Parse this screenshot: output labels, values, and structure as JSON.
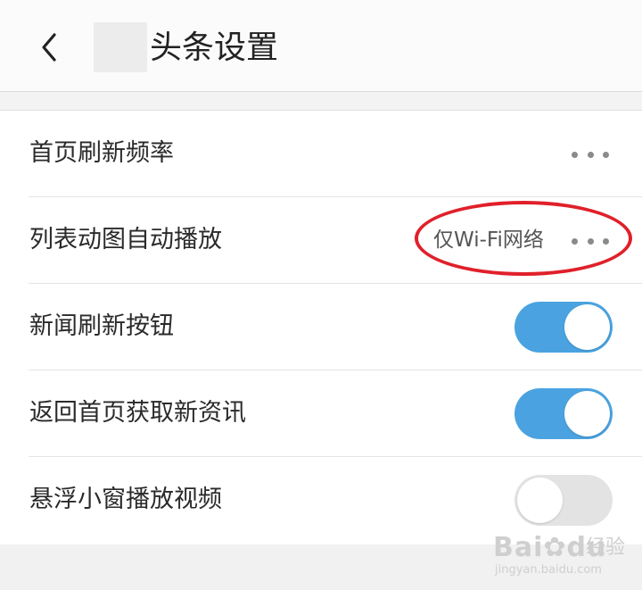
{
  "header": {
    "back_icon": "chevron-left-icon",
    "title": "头条设置"
  },
  "settings": [
    {
      "label": "首页刷新频率",
      "value": "",
      "control": "more"
    },
    {
      "label": "列表动图自动播放",
      "value": "仅Wi-Fi网络",
      "control": "more"
    },
    {
      "label": "新闻刷新按钮",
      "control": "toggle",
      "enabled": true
    },
    {
      "label": "返回首页获取新资讯",
      "control": "toggle",
      "enabled": true
    },
    {
      "label": "悬浮小窗播放视频",
      "control": "toggle",
      "enabled": false
    }
  ],
  "watermark": {
    "brand": "Bai",
    "brand_suffix": "du",
    "sub": "经验",
    "url": "jingyan.baidu.com"
  },
  "colors": {
    "toggle_on": "#4aa3e0",
    "toggle_off": "#e3e3e3",
    "annotation": "#e0202a"
  }
}
